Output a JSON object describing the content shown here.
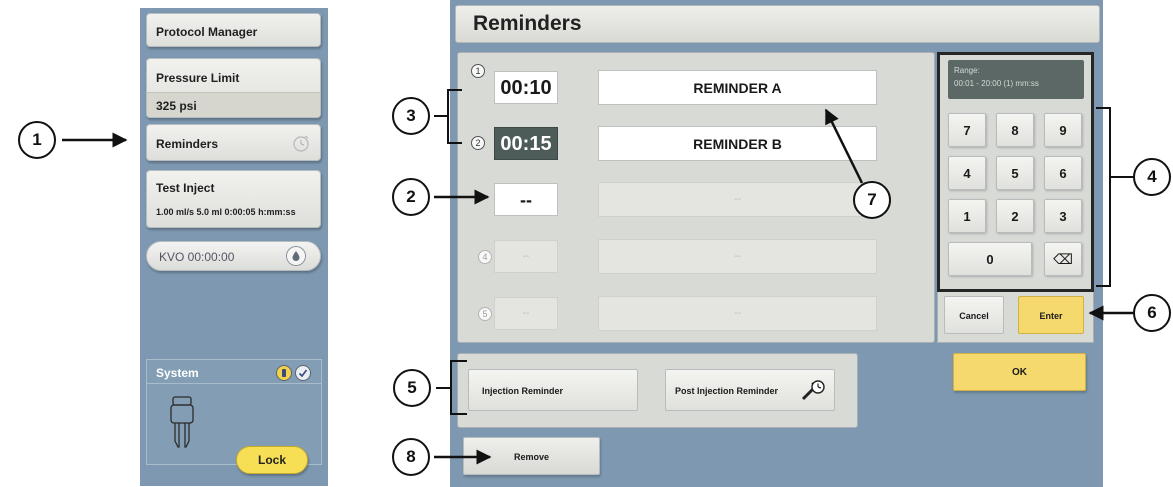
{
  "sidebar": {
    "protocol_manager": "Protocol Manager",
    "pressure_limit": {
      "label": "Pressure Limit",
      "value": "325 psi"
    },
    "reminders": "Reminders",
    "test_inject": {
      "label": "Test Inject",
      "value": "1.00 ml/s 5.0 ml 0:00:05 h:mm:ss"
    },
    "kvo": "KVO 00:00:00",
    "system": {
      "label": "System",
      "lock": "Lock"
    }
  },
  "main": {
    "title": "Reminders",
    "rows": [
      {
        "num": "1",
        "time": "00:10",
        "name": "REMINDER A"
      },
      {
        "num": "2",
        "time": "00:15",
        "name": "REMINDER B"
      },
      {
        "num": "",
        "time": "--",
        "name": "--"
      },
      {
        "num": "4",
        "time": "--",
        "name": "--"
      },
      {
        "num": "5",
        "time": "--",
        "name": "--"
      }
    ],
    "keypad": {
      "range_label": "Range:",
      "range_value": "00:01 - 20:00 (1) mm:ss",
      "keys": [
        "7",
        "8",
        "9",
        "4",
        "5",
        "6",
        "1",
        "2",
        "3",
        "0"
      ],
      "backspace": "⌫",
      "cancel": "Cancel",
      "enter": "Enter"
    },
    "ok": "OK",
    "injection_reminder": "Injection Reminder",
    "post_injection_reminder": "Post Injection Reminder",
    "remove": "Remove"
  },
  "callouts": [
    "1",
    "2",
    "3",
    "4",
    "5",
    "6",
    "7",
    "8"
  ],
  "colors": {
    "panel_blue": "#7d98b0",
    "panel_gray": "#d8dad6",
    "accent_yellow": "#f6d96d",
    "selected_dark": "#4e5c59"
  }
}
